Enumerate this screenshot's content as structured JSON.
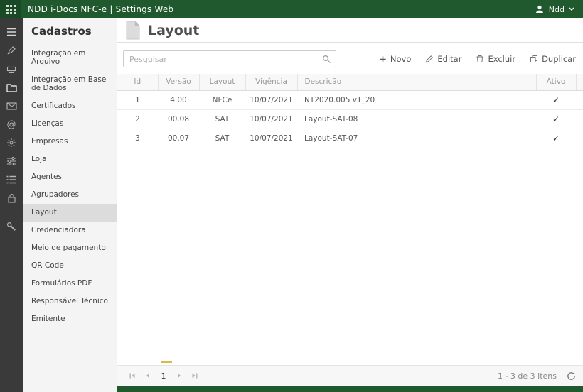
{
  "colors": {
    "brand_green": "#21592e",
    "selected_item_bg": "#dcdcdc",
    "accent_yellow": "#d8ba4c"
  },
  "topbar": {
    "app_title": "NDD i-Docs NFC-e | Settings Web",
    "user_name": "Ndd"
  },
  "sidebar": {
    "title": "Cadastros",
    "selected": "Layout",
    "items": [
      "Integração em Arquivo",
      "Integração em Base de Dados",
      "Certificados",
      "Licenças",
      "Empresas",
      "Loja",
      "Agentes",
      "Agrupadores",
      "Layout",
      "Credenciadora",
      "Meio de pagamento",
      "QR Code",
      "Formulários PDF",
      "Responsável Técnico",
      "Emitente"
    ]
  },
  "main": {
    "page_title": "Layout",
    "search": {
      "placeholder": "Pesquisar"
    },
    "toolbar": {
      "new_label": "Novo",
      "edit_label": "Editar",
      "delete_label": "Excluir",
      "duplicate_label": "Duplicar"
    },
    "table": {
      "columns": [
        "Id",
        "Versão",
        "Layout",
        "Vigência",
        "Descrição",
        "Ativo"
      ],
      "rows": [
        [
          "1",
          "4.00",
          "NFCe",
          "10/07/2021",
          "NT2020.005 v1_20",
          "✓"
        ],
        [
          "2",
          "00.08",
          "SAT",
          "10/07/2021",
          "Layout-SAT-08",
          "✓"
        ],
        [
          "3",
          "00.07",
          "SAT",
          "10/07/2021",
          "Layout-SAT-07",
          "✓"
        ]
      ]
    },
    "pagination": {
      "current_page": "1",
      "summary": "1 - 3 de 3 itens"
    }
  }
}
